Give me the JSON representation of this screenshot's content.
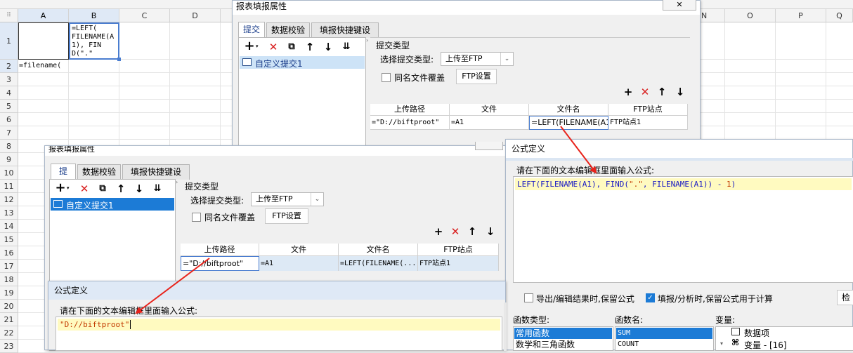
{
  "sheet": {
    "columns": [
      "A",
      "B",
      "C",
      "D",
      "N",
      "O",
      "P",
      "Q"
    ],
    "rows": [
      "1",
      "2",
      "3",
      "4",
      "5",
      "6",
      "7",
      "8",
      "9",
      "10",
      "11",
      "12",
      "13",
      "14",
      "15",
      "16",
      "17",
      "18",
      "19",
      "20",
      "21",
      "22",
      "23"
    ],
    "cell_B1": [
      "=LEFT(",
      "FILENAME(A",
      "1), FIN",
      "D(\".\""
    ],
    "cell_A2": "=filename("
  },
  "dialog1": {
    "title": "报表填报属性",
    "close": "✕",
    "tabs": [
      "提交",
      "数据校验",
      "填报快捷键设置"
    ],
    "list_item": "自定义提交1",
    "section_title": "提交类型",
    "type_label": "选择提交类型:",
    "type_value": "上传至FTP",
    "overwrite_label": "同名文件覆盖",
    "ftp_button": "FTP设置",
    "table_headers": [
      "上传路径",
      "文件",
      "文件名",
      "FTP站点"
    ],
    "row": [
      "=\"D://biftproot\"",
      "=A1",
      "=LEFT(FILENAME(A1",
      "FTP站点1"
    ]
  },
  "dialog2": {
    "title": "报表填报属性",
    "tabs": [
      "提交",
      "数据校验",
      "填报快捷键设置"
    ],
    "list_item": "自定义提交1",
    "section_title": "提交类型",
    "type_label": "选择提交类型:",
    "type_value": "上传至FTP",
    "overwrite_label": "同名文件覆盖",
    "ftp_button": "FTP设置",
    "table_headers": [
      "上传路径",
      "文件",
      "文件名",
      "FTP站点"
    ],
    "row": [
      "=\"D://biftproot\"",
      "=A1",
      "=LEFT(FILENAME(...",
      "FTP站点1"
    ]
  },
  "formula_dialog_right": {
    "title": "公式定义",
    "prompt": "请在下面的文本编辑框里面输入公式:",
    "formula_parts": [
      "LEFT(FILENAME(A1), FIND(",
      "\".\"",
      ", FILENAME(A1)) - ",
      "1",
      ")"
    ],
    "keep_formula_export": "导出/编辑结果时,保留公式",
    "keep_formula_fill": "填报/分析时,保留公式用于计算",
    "check_button": "检",
    "func_type_label": "函数类型:",
    "func_name_label": "函数名:",
    "var_label": "变量:",
    "func_types": [
      "常用函数",
      "数学和三角函数"
    ],
    "func_names": [
      "SUM",
      "COUNT"
    ],
    "vars": [
      "数据项",
      "变量 - [16]"
    ]
  },
  "formula_dialog_bottom": {
    "title": "公式定义",
    "prompt": "请在下面的文本编辑框里面输入公式:",
    "formula": "\"D://biftproot\""
  },
  "colors": {
    "accent": "#1c7bd6",
    "arrow": "#e8241c",
    "highlight": "#fffac0"
  }
}
